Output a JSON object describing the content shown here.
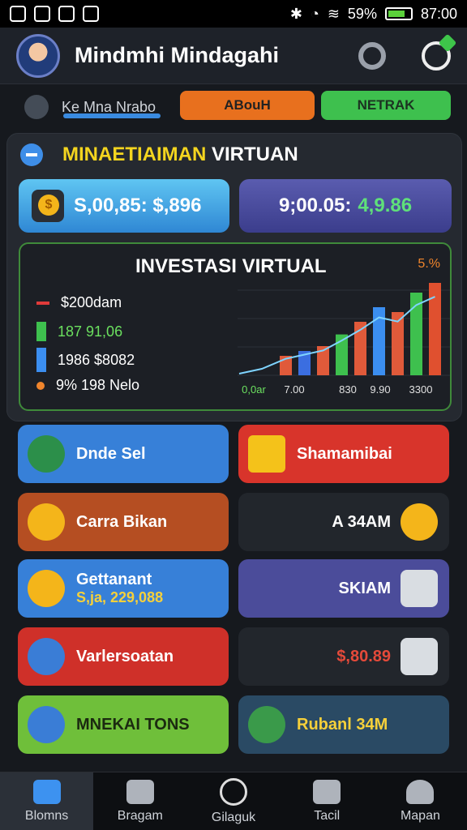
{
  "status_bar": {
    "battery_text": "59%",
    "time": "87:00"
  },
  "header": {
    "title": "Mindmhi Mindagahi"
  },
  "subheader": {
    "label": "Ke Mna Nrabo",
    "tab_orange": "ABouH",
    "tab_green": "NETRAK"
  },
  "card": {
    "title_yellow": "MINAETIAIMAN",
    "title_white": "VIRTUAN",
    "balance_left": "S,00,85: $,896",
    "balance_right_a": "9;00.05:",
    "balance_right_b": "4,9.86"
  },
  "chart": {
    "title": "INVESTASI VIRTUAL",
    "pct": "5.%",
    "legend": [
      {
        "text": "$200dam",
        "color": "#ffffff"
      },
      {
        "text": "187 91,06",
        "color": "#6be05f"
      },
      {
        "text": "1986 $8082",
        "color": "#ffffff"
      },
      {
        "text": "9% 198 Nelo",
        "color": "#ffffff"
      }
    ],
    "x_ticks": [
      "0,0ar",
      "7.00",
      "830",
      "9.90",
      "3300"
    ]
  },
  "chart_data": {
    "type": "bar",
    "title": "INVESTASI VIRTUAL",
    "categories": [
      "0,0ar",
      "7.00",
      "830",
      "9.90",
      "3300"
    ],
    "series": [
      {
        "values": [
          20,
          25,
          30,
          42,
          55,
          70,
          65,
          85,
          95
        ]
      }
    ]
  },
  "tiles": [
    {
      "label": "Dnde Sel",
      "color": "#3780d8"
    },
    {
      "label": "Shamamibai",
      "color": "#d8342b"
    },
    {
      "label": "Carra Bikan",
      "color": "#b54e22"
    },
    {
      "label": "A 34AM",
      "color": "#22262c"
    },
    {
      "label": "Gettanant",
      "sub": "S,ja, 229,088",
      "color": "#3780d8"
    },
    {
      "label": "SKIAM",
      "color": "#4b4c9a"
    },
    {
      "label": "Varlersoatan",
      "color": "#cf3029"
    },
    {
      "label": "$,80.89",
      "color": "#22262c"
    },
    {
      "label": "MNEKAI TONS",
      "color": "#6fbf3a"
    },
    {
      "label": "Rubanl 34M",
      "color": "#2a4a64"
    }
  ],
  "nav": [
    "Blomns",
    "Bragam",
    "Gilaguk",
    "Tacil",
    "Mapan"
  ]
}
